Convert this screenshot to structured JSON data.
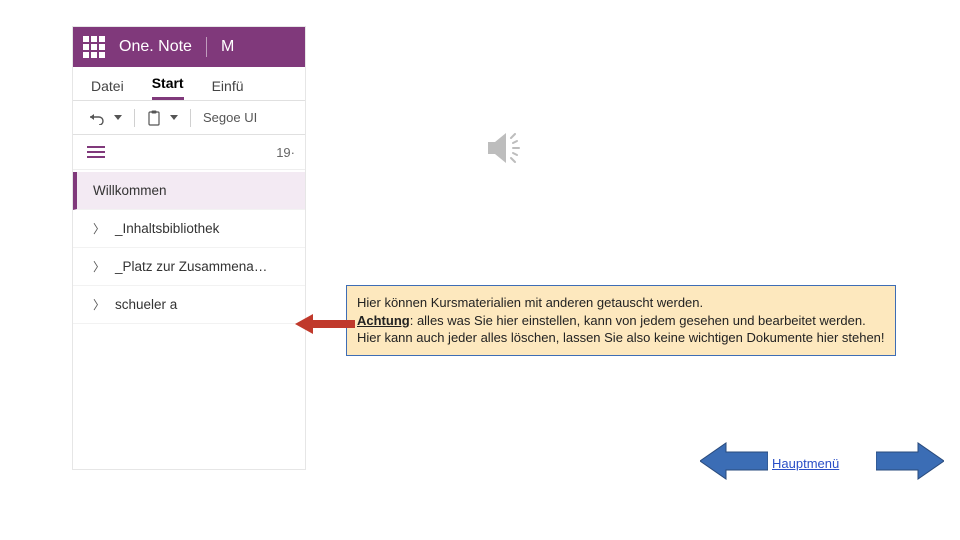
{
  "onenote": {
    "app_title": "One. Note",
    "tail_letter": "M",
    "tabs": {
      "datei": "Datei",
      "start": "Start",
      "einfuegen_trunc": "Einfü"
    },
    "toolbar": {
      "font": "Segoe UI"
    },
    "page_date_trunc": "19·",
    "sections": {
      "willkommen": "Willkommen",
      "inhaltsbibliothek": "_Inhaltsbibliothek",
      "platz_zusammen": "_Platz zur Zusammena…",
      "schueler_a": "schueler a"
    }
  },
  "callout": {
    "line1": "Hier können Kursmaterialien mit anderen getauscht werden.",
    "achtung_label": "Achtung",
    "line2_rest": ": alles was Sie hier einstellen, kann von jedem gesehen und bearbeitet werden. Hier kann auch jeder alles löschen, lassen Sie also keine wichtigen Dokumente hier stehen!"
  },
  "nav": {
    "main_menu": "Hauptmenü"
  }
}
